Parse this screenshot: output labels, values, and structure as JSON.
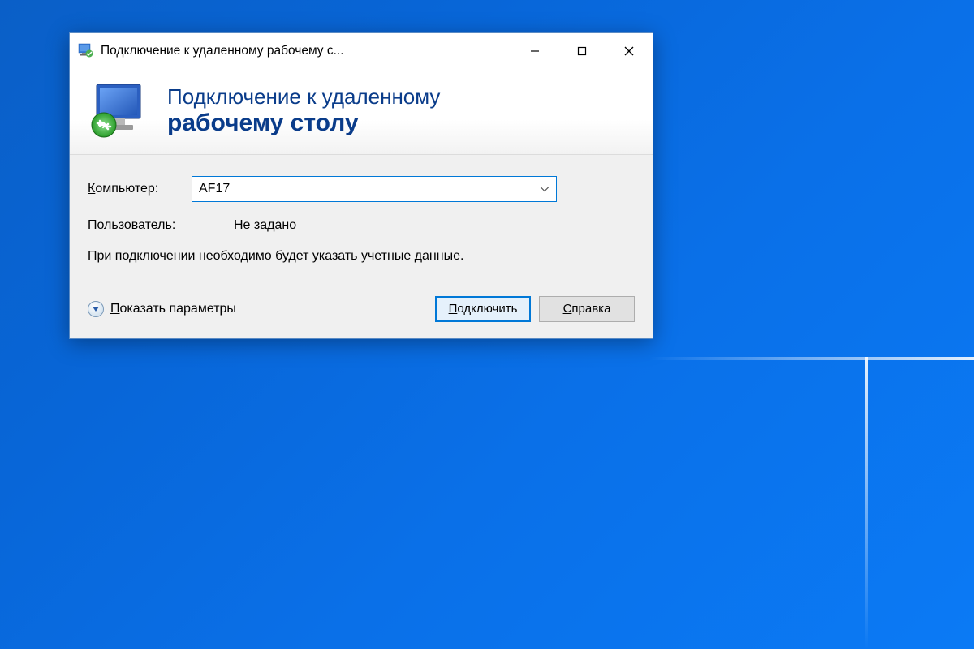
{
  "window": {
    "title": "Подключение к удаленному рабочему с...",
    "header_line1": "Подключение к удаленному",
    "header_line2": "рабочему столу"
  },
  "form": {
    "computer_label_prefix": "К",
    "computer_label_rest": "омпьютер:",
    "computer_value": "AF17",
    "user_label": "Пользователь:",
    "user_value": "Не задано",
    "info_text": "При подключении необходимо будет указать учетные данные."
  },
  "footer": {
    "show_options_prefix": "П",
    "show_options_rest": "оказать параметры",
    "connect_prefix": "П",
    "connect_rest": "одключить",
    "help_prefix": "С",
    "help_rest": "правка"
  }
}
